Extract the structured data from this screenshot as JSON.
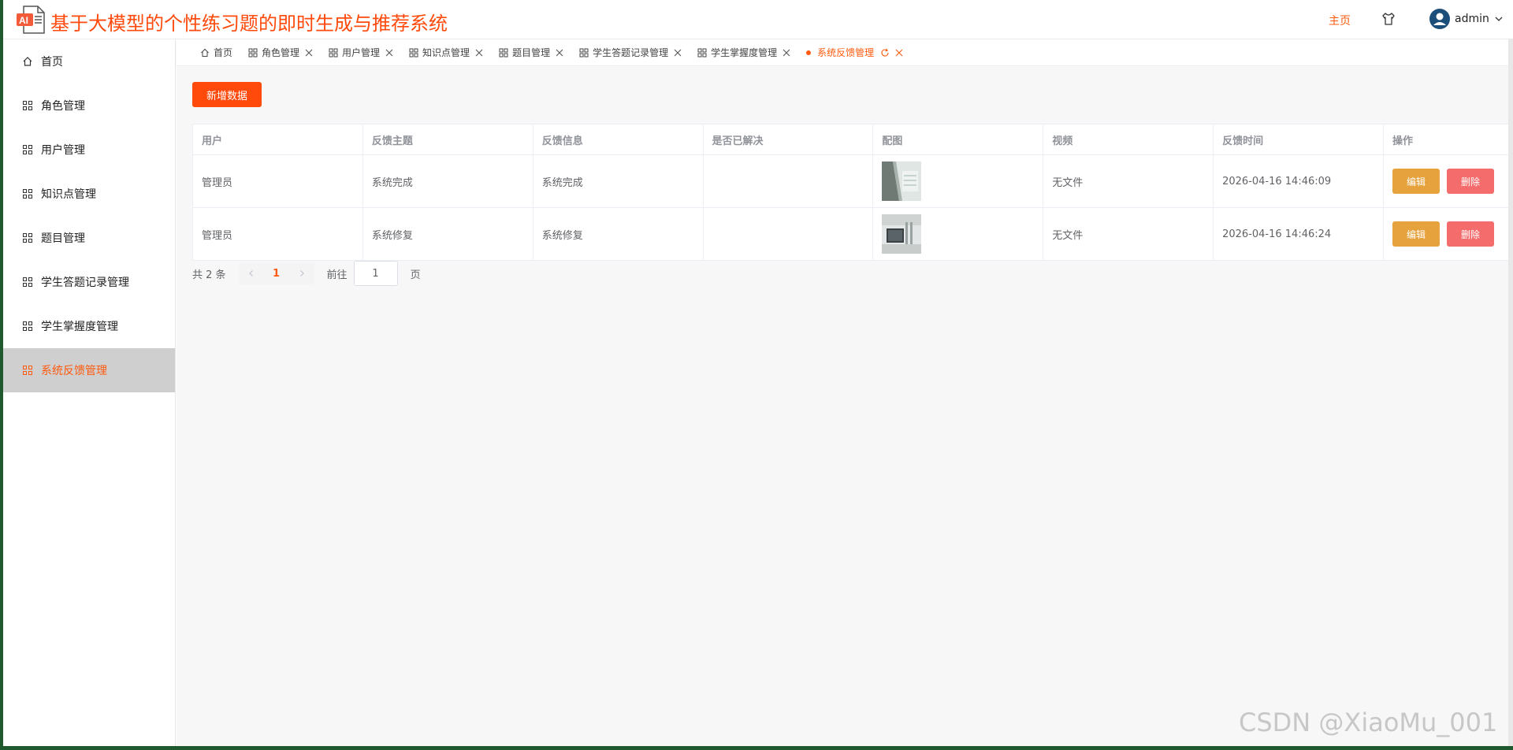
{
  "header": {
    "logo_text": "AI",
    "title": "基于大模型的个性练习题的即时生成与推荐系统",
    "home_link": "主页",
    "user_name": "admin"
  },
  "sidebar": {
    "items": [
      {
        "label": "首页",
        "icon": "home-icon"
      },
      {
        "label": "角色管理",
        "icon": "grid-icon"
      },
      {
        "label": "用户管理",
        "icon": "grid-icon"
      },
      {
        "label": "知识点管理",
        "icon": "grid-icon"
      },
      {
        "label": "题目管理",
        "icon": "grid-icon"
      },
      {
        "label": "学生答题记录管理",
        "icon": "grid-icon"
      },
      {
        "label": "学生掌握度管理",
        "icon": "grid-icon"
      },
      {
        "label": "系统反馈管理",
        "icon": "grid-icon",
        "active": true
      }
    ]
  },
  "tabs": [
    {
      "label": "首页"
    },
    {
      "label": "角色管理"
    },
    {
      "label": "用户管理"
    },
    {
      "label": "知识点管理"
    },
    {
      "label": "题目管理"
    },
    {
      "label": "学生答题记录管理"
    },
    {
      "label": "学生掌握度管理"
    },
    {
      "label": "系统反馈管理",
      "active": true
    }
  ],
  "toolbar": {
    "add_label": "新增数据"
  },
  "table": {
    "headers": [
      "用户",
      "反馈主题",
      "反馈信息",
      "是否已解决",
      "配图",
      "视频",
      "反馈时间",
      "操作"
    ],
    "rows": [
      {
        "user": "管理员",
        "topic": "系统完成",
        "info": "系统完成",
        "resolved": "",
        "video": "无文件",
        "time": "2026-04-16 14:46:09"
      },
      {
        "user": "管理员",
        "topic": "系统修复",
        "info": "系统修复",
        "resolved": "",
        "video": "无文件",
        "time": "2026-04-16 14:46:24"
      }
    ],
    "edit_label": "编辑",
    "delete_label": "删除"
  },
  "pagination": {
    "total_text": "共 2 条",
    "current_page": "1",
    "goto_label": "前往",
    "goto_value": "1",
    "page_suffix": "页"
  },
  "watermark": "CSDN @XiaoMu_001",
  "colors": {
    "accent": "#ff4a0c",
    "edit": "#e6a23c",
    "delete": "#f56c6c",
    "active_bg": "#cfcfcf"
  }
}
